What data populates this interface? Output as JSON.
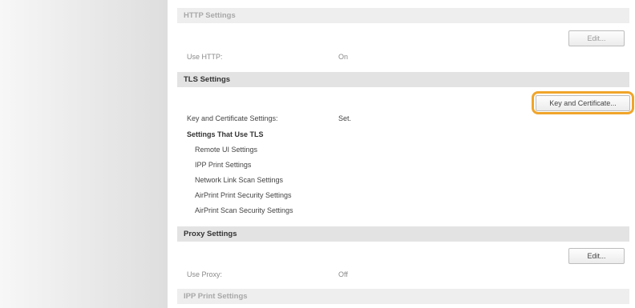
{
  "http": {
    "header": "HTTP Settings",
    "edit_label": "Edit...",
    "use_label": "Use HTTP:",
    "use_value": "On"
  },
  "tls": {
    "header": "TLS Settings",
    "key_button_label": "Key and Certificate...",
    "key_label": "Key and Certificate Settings:",
    "key_value": "Set.",
    "subheading": "Settings That Use TLS",
    "items": [
      "Remote UI Settings",
      "IPP Print Settings",
      "Network Link Scan Settings",
      "AirPrint Print Security Settings",
      "AirPrint Scan Security Settings"
    ]
  },
  "proxy": {
    "header": "Proxy Settings",
    "edit_label": "Edit...",
    "use_label": "Use Proxy:",
    "use_value": "Off"
  },
  "ipp": {
    "header": "IPP Print Settings"
  },
  "colors": {
    "highlight": "#f0a52a",
    "header_bg": "#e3e3e3"
  }
}
